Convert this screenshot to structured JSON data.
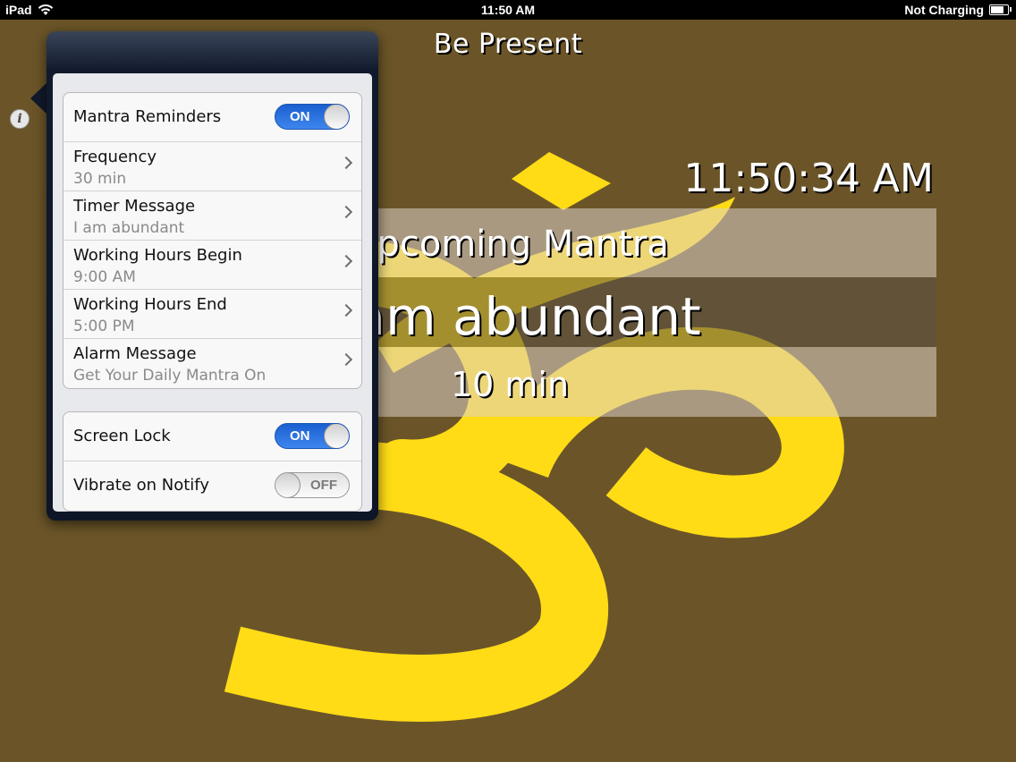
{
  "status_bar": {
    "device": "iPad",
    "time": "11:50 AM",
    "charging": "Not Charging",
    "icons": {
      "wifi": "wifi-icon",
      "battery": "battery-icon"
    },
    "battery_level": 0.9
  },
  "app": {
    "title": "Be Present",
    "clock": "11:50:34 AM",
    "upcoming_label": "Upcoming Mantra",
    "mantra": "I am abundant",
    "remaining": "10 min",
    "colors": {
      "background": "#6b5528",
      "symbol": "#ffdc16"
    }
  },
  "settings": {
    "group1": [
      {
        "id": "mantra-reminders",
        "title": "Mantra Reminders",
        "type": "toggle",
        "state": "ON"
      },
      {
        "id": "frequency",
        "title": "Frequency",
        "value": "30 min",
        "type": "disclosure"
      },
      {
        "id": "timer-message",
        "title": "Timer Message",
        "value": "I am abundant",
        "type": "disclosure"
      },
      {
        "id": "working-hours-begin",
        "title": "Working Hours Begin",
        "value": "9:00 AM",
        "type": "disclosure"
      },
      {
        "id": "working-hours-end",
        "title": "Working Hours End",
        "value": "5:00 PM",
        "type": "disclosure"
      },
      {
        "id": "alarm-message",
        "title": "Alarm Message",
        "value": "Get Your Daily Mantra On",
        "type": "disclosure"
      }
    ],
    "group2": [
      {
        "id": "screen-lock",
        "title": "Screen Lock",
        "type": "toggle",
        "state": "ON"
      },
      {
        "id": "vibrate-on-notify",
        "title": "Vibrate on Notify",
        "type": "toggle",
        "state": "OFF"
      }
    ]
  }
}
